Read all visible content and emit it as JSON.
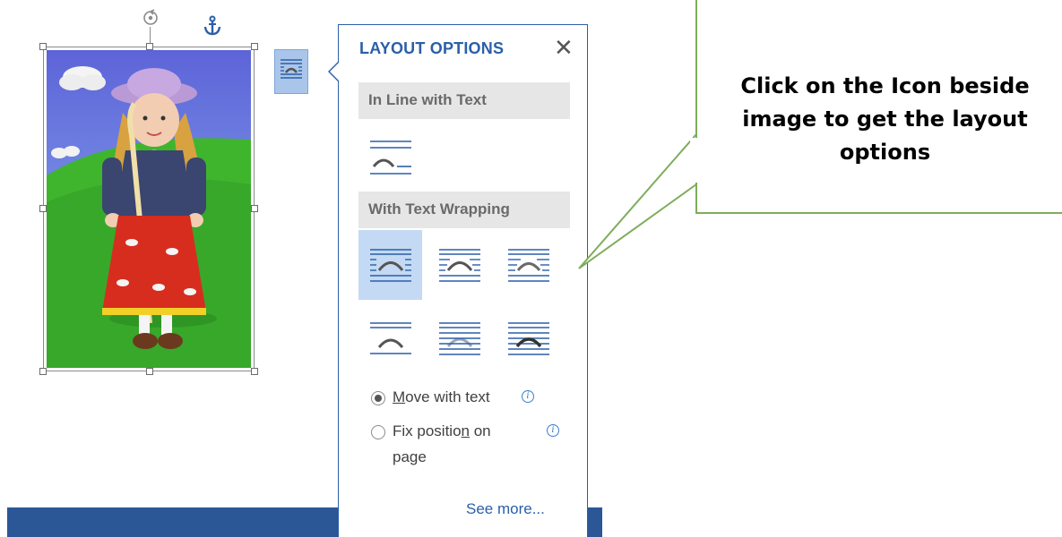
{
  "panel": {
    "title": "LAYOUT OPTIONS",
    "close_icon": "close-icon",
    "section_inline": "In Line with Text",
    "section_wrapping": "With Text Wrapping",
    "selected_option": "square",
    "wrap_options": [
      "square",
      "tight",
      "through",
      "top-and-bottom",
      "behind-text",
      "in-front-of-text"
    ],
    "move_with_text": {
      "pre": "",
      "u": "M",
      "post": "ove with text",
      "checked": true
    },
    "fix_position": {
      "pre": "Fix positio",
      "u": "n",
      "post": " on",
      "line2": "page",
      "checked": false
    },
    "see_more": "See more..."
  },
  "image": {
    "rotate_icon": "rotate-handle-icon",
    "anchor_icon": "anchor-icon",
    "layout_button_icon": "layout-options-icon"
  },
  "callout": {
    "text": "Click on the Icon beside image to get the layout options"
  },
  "colors": {
    "accent": "#2a5fa8",
    "selected": "#c4d9f3",
    "callout_border": "#7dad5a",
    "bar": "#2b5797"
  }
}
